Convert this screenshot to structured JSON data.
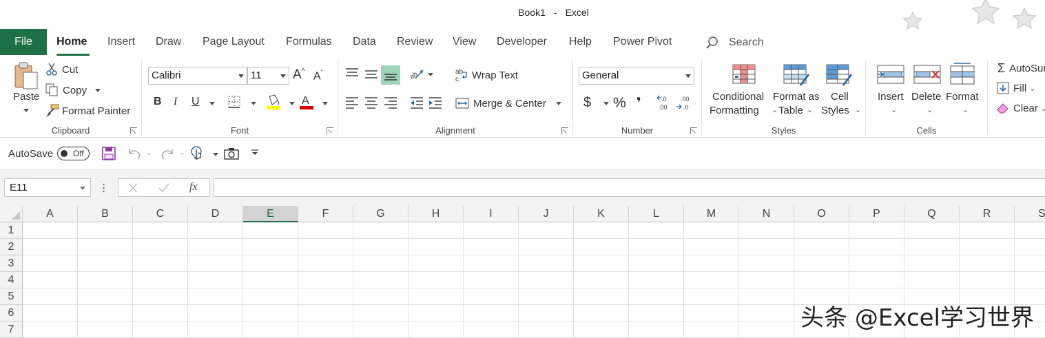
{
  "window": {
    "doc_name": "Book1",
    "separator": "-",
    "app_name": "Excel"
  },
  "tabs": {
    "file": "File",
    "items": [
      "Home",
      "Insert",
      "Draw",
      "Page Layout",
      "Formulas",
      "Data",
      "Review",
      "View",
      "Developer",
      "Help",
      "Power Pivot"
    ],
    "active": "Home",
    "search_label": "Search"
  },
  "clipboard": {
    "paste": "Paste",
    "cut": "Cut",
    "copy": "Copy",
    "format_painter": "Format Painter",
    "group_label": "Clipboard"
  },
  "font": {
    "name": "Calibri",
    "size": "11",
    "bold": "B",
    "italic": "I",
    "underline": "U",
    "group_label": "Font"
  },
  "alignment": {
    "wrap_text": "Wrap Text",
    "merge_center": "Merge & Center",
    "group_label": "Alignment"
  },
  "number": {
    "format": "General",
    "currency": "$",
    "percent": "%",
    "comma": "❜",
    "group_label": "Number"
  },
  "styles": {
    "conditional_1": "Conditional",
    "conditional_2": "Formatting",
    "format_table_1": "Format as",
    "format_table_2": "Table",
    "cell_styles_1": "Cell",
    "cell_styles_2": "Styles",
    "group_label": "Styles"
  },
  "cells_group": {
    "insert": "Insert",
    "delete": "Delete",
    "format": "Format",
    "group_label": "Cells"
  },
  "editing": {
    "autosum": "AutoSum",
    "fill": "Fill",
    "clear": "Clear"
  },
  "qat": {
    "autosave": "AutoSave",
    "toggle_state": "Off"
  },
  "formula_bar": {
    "name_box": "E11",
    "fx": "fx",
    "content": ""
  },
  "grid": {
    "columns": [
      "A",
      "B",
      "C",
      "D",
      "E",
      "F",
      "G",
      "H",
      "I",
      "J",
      "K",
      "L",
      "M",
      "N",
      "O",
      "P",
      "Q",
      "R",
      "S"
    ],
    "rows": [
      "1",
      "2",
      "3",
      "4",
      "5",
      "6",
      "7"
    ],
    "active_column": "E"
  },
  "watermark": "头条 @Excel学习世界",
  "colors": {
    "accent": "#1e7145",
    "selected_align": "#9fd5b7",
    "fill_yellow": "#ffff00",
    "font_red": "#e00000"
  }
}
